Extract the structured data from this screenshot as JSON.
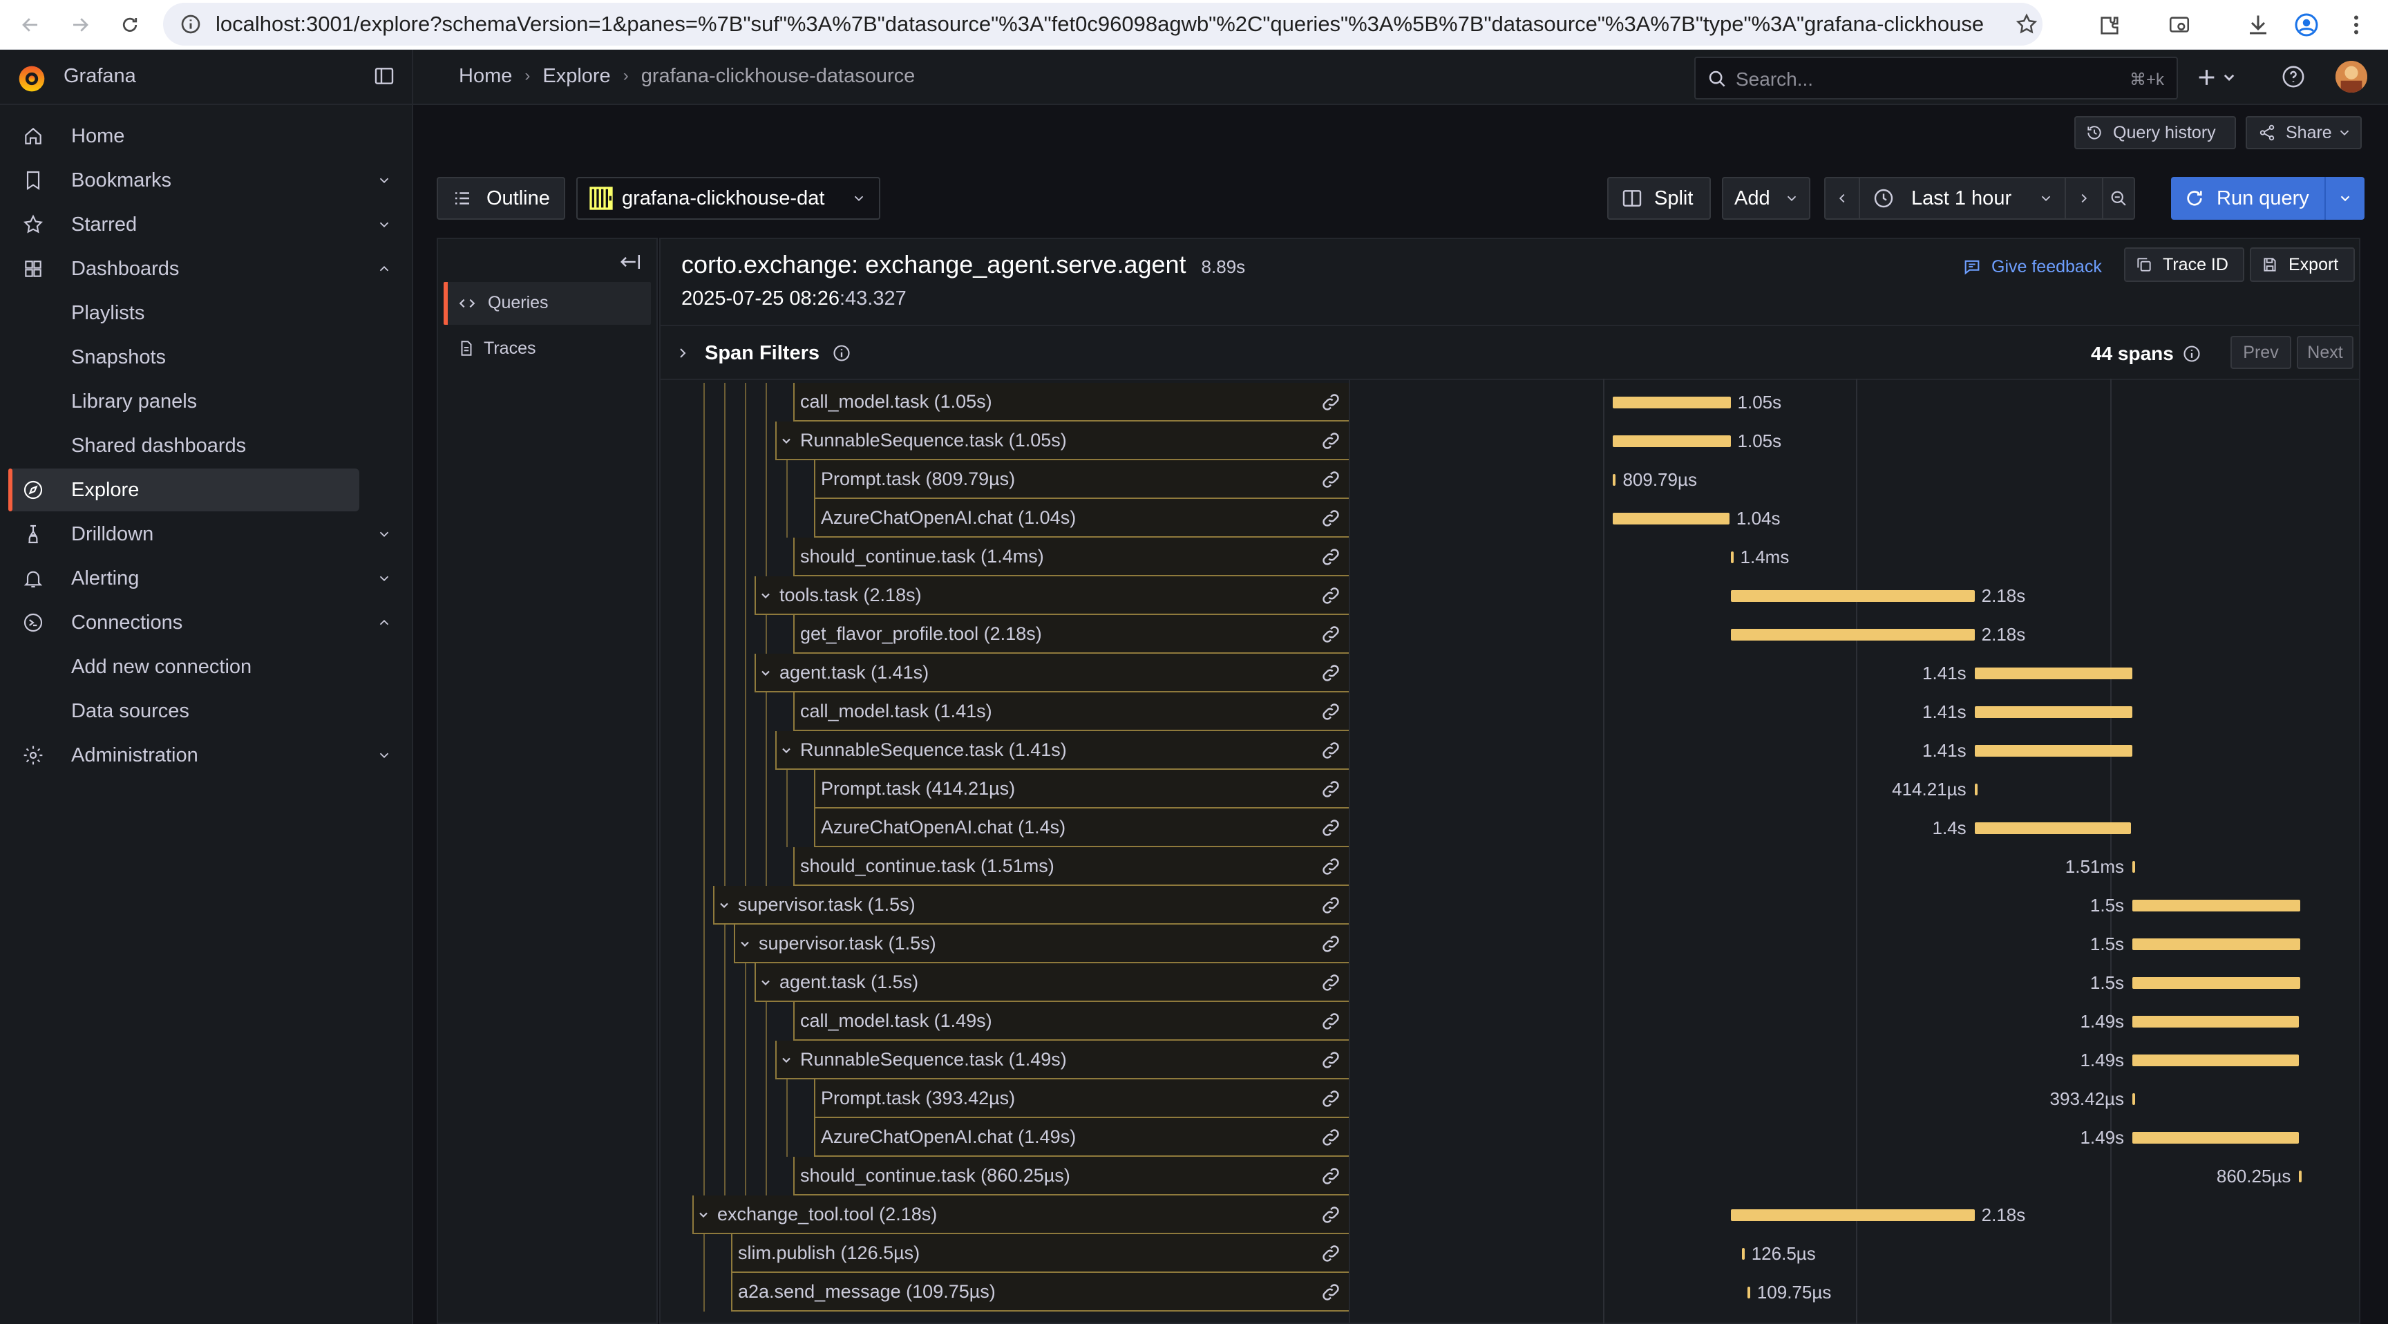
{
  "browser": {
    "url": "localhost:3001/explore?schemaVersion=1&panes=%7B\"suf\"%3A%7B\"datasource\"%3A\"fet0c96098agwb\"%2C\"queries\"%3A%5B%7B\"datasource\"%3A%7B\"type\"%3A\"grafana-clickhouse-datas..."
  },
  "app": {
    "name": "Grafana"
  },
  "breadcrumb": [
    "Home",
    "Explore",
    "grafana-clickhouse-datasource"
  ],
  "search": {
    "placeholder": "Search...",
    "shortcut": "⌘+k"
  },
  "nav": {
    "items": [
      {
        "label": "Home",
        "icon": "home-icon"
      },
      {
        "label": "Bookmarks",
        "icon": "bookmark-icon"
      },
      {
        "label": "Starred",
        "icon": "star-icon"
      },
      {
        "label": "Dashboards",
        "icon": "apps-icon"
      },
      {
        "label": "Playlists"
      },
      {
        "label": "Snapshots"
      },
      {
        "label": "Library panels"
      },
      {
        "label": "Shared dashboards"
      },
      {
        "label": "Explore",
        "icon": "compass-icon"
      },
      {
        "label": "Drilldown",
        "icon": "drilldown-icon"
      },
      {
        "label": "Alerting",
        "icon": "bell-icon"
      },
      {
        "label": "Connections",
        "icon": "connections-icon"
      },
      {
        "label": "Add new connection"
      },
      {
        "label": "Data sources"
      },
      {
        "label": "Administration",
        "icon": "cog-icon"
      }
    ]
  },
  "toolbar": {
    "query_history": "Query history",
    "share": "Share",
    "outline": "Outline",
    "datasource": "grafana-clickhouse-dat",
    "split": "Split",
    "add": "Add",
    "time_range": "Last 1 hour",
    "run_query": "Run query"
  },
  "outline_pane": {
    "items": [
      "Queries",
      "Traces"
    ]
  },
  "trace": {
    "title": "corto.exchange: exchange_agent.serve.agent",
    "duration": "8.89s",
    "timestamp_main": "2025-07-25 08:26",
    "timestamp_ms": ":43.327",
    "give_feedback": "Give feedback",
    "trace_id": "Trace ID",
    "export": "Export",
    "span_filters": "Span Filters",
    "span_count": "44 spans",
    "prev": "Prev",
    "next": "Next"
  },
  "spans": [
    {
      "name": "call_model.task (1.05s)",
      "depth": 3,
      "toggle": false,
      "duration_label": "1.05s",
      "start_s": 2.25,
      "duration_s": 1.05
    },
    {
      "name": "RunnableSequence.task (1.05s)",
      "depth": 3,
      "toggle": true,
      "duration_label": "1.05s",
      "start_s": 2.25,
      "duration_s": 1.05
    },
    {
      "name": "Prompt.task (809.79µs)",
      "depth": 4,
      "toggle": false,
      "duration_label": "809.79µs",
      "start_s": 2.25,
      "duration_s": 0.0008
    },
    {
      "name": "AzureChatOpenAI.chat (1.04s)",
      "depth": 4,
      "toggle": false,
      "duration_label": "1.04s",
      "start_s": 2.25,
      "duration_s": 1.04
    },
    {
      "name": "should_continue.task (1.4ms)",
      "depth": 3,
      "toggle": false,
      "duration_label": "1.4ms",
      "start_s": 3.3,
      "duration_s": 0.0014
    },
    {
      "name": "tools.task (2.18s)",
      "depth": 2,
      "toggle": true,
      "duration_label": "2.18s",
      "start_s": 3.3,
      "duration_s": 2.18
    },
    {
      "name": "get_flavor_profile.tool (2.18s)",
      "depth": 3,
      "toggle": false,
      "duration_label": "2.18s",
      "start_s": 3.3,
      "duration_s": 2.18
    },
    {
      "name": "agent.task (1.41s)",
      "depth": 2,
      "toggle": true,
      "duration_label": "1.41s",
      "start_s": 5.48,
      "duration_s": 1.41
    },
    {
      "name": "call_model.task (1.41s)",
      "depth": 3,
      "toggle": false,
      "duration_label": "1.41s",
      "start_s": 5.48,
      "duration_s": 1.41
    },
    {
      "name": "RunnableSequence.task (1.41s)",
      "depth": 3,
      "toggle": true,
      "duration_label": "1.41s",
      "start_s": 5.48,
      "duration_s": 1.41
    },
    {
      "name": "Prompt.task (414.21µs)",
      "depth": 4,
      "toggle": false,
      "duration_label": "414.21µs",
      "start_s": 5.48,
      "duration_s": 0.0004
    },
    {
      "name": "AzureChatOpenAI.chat (1.4s)",
      "depth": 4,
      "toggle": false,
      "duration_label": "1.4s",
      "start_s": 5.48,
      "duration_s": 1.4
    },
    {
      "name": "should_continue.task (1.51ms)",
      "depth": 3,
      "toggle": false,
      "duration_label": "1.51ms",
      "start_s": 6.89,
      "duration_s": 0.0015
    },
    {
      "name": "supervisor.task (1.5s)",
      "depth": 0,
      "toggle": true,
      "duration_label": "1.5s",
      "start_s": 6.89,
      "duration_s": 1.5
    },
    {
      "name": "supervisor.task (1.5s)",
      "depth": 1,
      "toggle": true,
      "duration_label": "1.5s",
      "start_s": 6.89,
      "duration_s": 1.5
    },
    {
      "name": "agent.task (1.5s)",
      "depth": 2,
      "toggle": true,
      "duration_label": "1.5s",
      "start_s": 6.89,
      "duration_s": 1.5
    },
    {
      "name": "call_model.task (1.49s)",
      "depth": 3,
      "toggle": false,
      "duration_label": "1.49s",
      "start_s": 6.89,
      "duration_s": 1.49
    },
    {
      "name": "RunnableSequence.task (1.49s)",
      "depth": 3,
      "toggle": true,
      "duration_label": "1.49s",
      "start_s": 6.89,
      "duration_s": 1.49
    },
    {
      "name": "Prompt.task (393.42µs)",
      "depth": 4,
      "toggle": false,
      "duration_label": "393.42µs",
      "start_s": 6.89,
      "duration_s": 0.0004
    },
    {
      "name": "AzureChatOpenAI.chat (1.49s)",
      "depth": 4,
      "toggle": false,
      "duration_label": "1.49s",
      "start_s": 6.89,
      "duration_s": 1.49
    },
    {
      "name": "should_continue.task (860.25µs)",
      "depth": 3,
      "toggle": false,
      "duration_label": "860.25µs",
      "start_s": 8.38,
      "duration_s": 0.0009
    },
    {
      "name": "exchange_tool.tool (2.18s)",
      "depth": -1,
      "toggle": true,
      "duration_label": "2.18s",
      "start_s": 3.3,
      "duration_s": 2.18
    },
    {
      "name": "slim.publish (126.5µs)",
      "depth": 0,
      "toggle": false,
      "duration_label": "126.5µs",
      "start_s": 3.4,
      "duration_s": 0.0001
    },
    {
      "name": "a2a.send_message (109.75µs)",
      "depth": 0,
      "toggle": false,
      "duration_label": "109.75µs",
      "start_s": 3.45,
      "duration_s": 0.0001
    }
  ],
  "timeline": {
    "total_s": 8.89
  },
  "colors": {
    "accent": "#3d71d9",
    "bar": "#f0c86f",
    "active": "#f55f3e"
  }
}
